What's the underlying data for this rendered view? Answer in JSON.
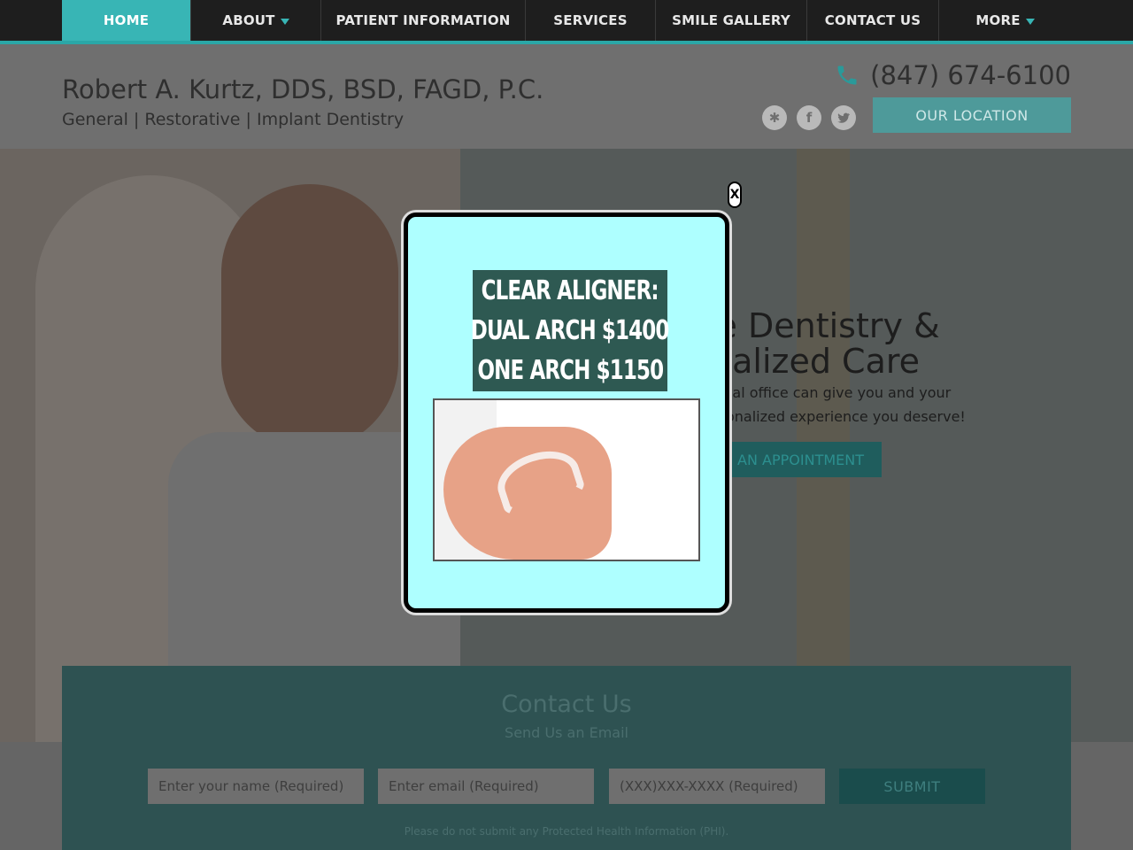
{
  "nav": {
    "items": [
      {
        "label": "HOME"
      },
      {
        "label": "ABOUT"
      },
      {
        "label": "PATIENT INFORMATION"
      },
      {
        "label": "SERVICES"
      },
      {
        "label": "SMILE GALLERY"
      },
      {
        "label": "CONTACT US"
      },
      {
        "label": "MORE"
      }
    ]
  },
  "header": {
    "title": "Robert A. Kurtz, DDS, BSD, FAGD, P.C.",
    "subtitle": "General | Restorative | Implant Dentistry",
    "phone": "(847) 674-6100",
    "location_button": "OUR LOCATION",
    "social": [
      {
        "name": "yelp-icon",
        "glyph": "✱"
      },
      {
        "name": "facebook-icon",
        "glyph": "f"
      },
      {
        "name": "twitter-icon",
        "glyph": "🐦"
      }
    ]
  },
  "hero": {
    "heading_line1": "ntle Dentistry &",
    "heading_line2": "sonalized Care",
    "text_line1": "ate dental office can give you and your",
    "text_line2": "ne personalized experience you deserve!",
    "button": "E AN APPOINTMENT"
  },
  "contact": {
    "title": "Contact Us",
    "subtitle": "Send Us an Email",
    "name_placeholder": "Enter your name (Required)",
    "email_placeholder": "Enter email (Required)",
    "phone_placeholder": "(XXX)XXX-XXXX (Required)",
    "submit": "SUBMIT",
    "note": "Please do not submit any Protected Health Information (PHI)."
  },
  "popup": {
    "close": "X",
    "promo_line1": "CLEAR ALIGNER:",
    "promo_line2": "DUAL ARCH $1400",
    "promo_line3": "ONE ARCH $1150"
  },
  "colors": {
    "accent": "#38b5b5",
    "popup_bg": "#aeffff",
    "promo_bg": "#2e5952"
  }
}
